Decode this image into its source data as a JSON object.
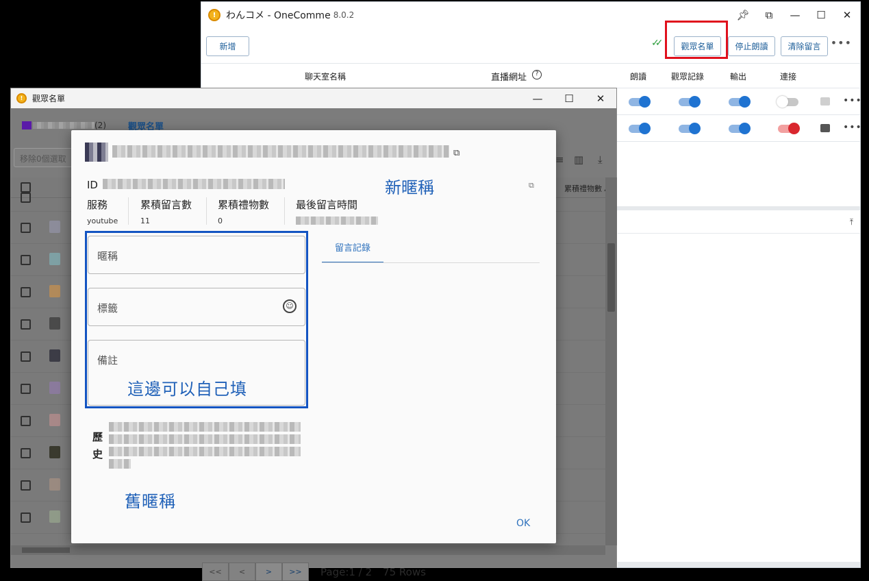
{
  "main_window": {
    "title": "わんコメ - OneComme",
    "version": "8.0.2",
    "logo": "onecomme-logo",
    "window_controls": [
      "pin-icon",
      "pip-icon",
      "minimize-icon",
      "maximize-icon",
      "close-icon"
    ],
    "toolbar": {
      "new_label": "新增",
      "viewer_list_label": "觀眾名單",
      "stop_reading_label": "停止朗讀",
      "clear_comments_label": "清除留言"
    },
    "columns": {
      "room_name": "聊天室名稱",
      "stream_url": "直播網址",
      "read_aloud": "朗讀",
      "viewer_record": "觀眾記錄",
      "output": "輸出",
      "connect": "連接"
    },
    "rows": [
      {
        "read_aloud": true,
        "viewer_record": true,
        "output": true,
        "connect": false
      },
      {
        "read_aloud": true,
        "viewer_record": true,
        "output": true,
        "connect": true
      }
    ],
    "connect_on_color": "#d9272e",
    "highlight_color": "#e0101c"
  },
  "viewer_window": {
    "title": "觀眾名單",
    "owner_count": "(2)",
    "tab_label": "觀眾名單",
    "remove_button_label": "移除0個選取",
    "grid_header_gift": "累積禮物數",
    "pager": {
      "first": "<<",
      "prev": "<",
      "next": ">",
      "last": ">>",
      "page_text": "Page:1 / 2",
      "rows_text": "75 Rows"
    }
  },
  "dialog": {
    "id_label": "ID",
    "stats": [
      {
        "label": "服務",
        "value": "youtube"
      },
      {
        "label": "累積留言數",
        "value": "11"
      },
      {
        "label": "累積禮物數",
        "value": "0"
      },
      {
        "label": "最後留言時間",
        "value": ""
      }
    ],
    "fields": {
      "nickname_placeholder": "暱稱",
      "tags_placeholder": "標籤",
      "notes_placeholder": "備註"
    },
    "tab_comments": "留言記錄",
    "history_label": "歷史",
    "ok_label": "OK"
  },
  "annotations": {
    "new_nickname": "新暱稱",
    "fill_yourself": "這邊可以自己填",
    "old_nickname": "舊暱稱",
    "color": "#2061b8",
    "box_color": "#1354c2"
  }
}
